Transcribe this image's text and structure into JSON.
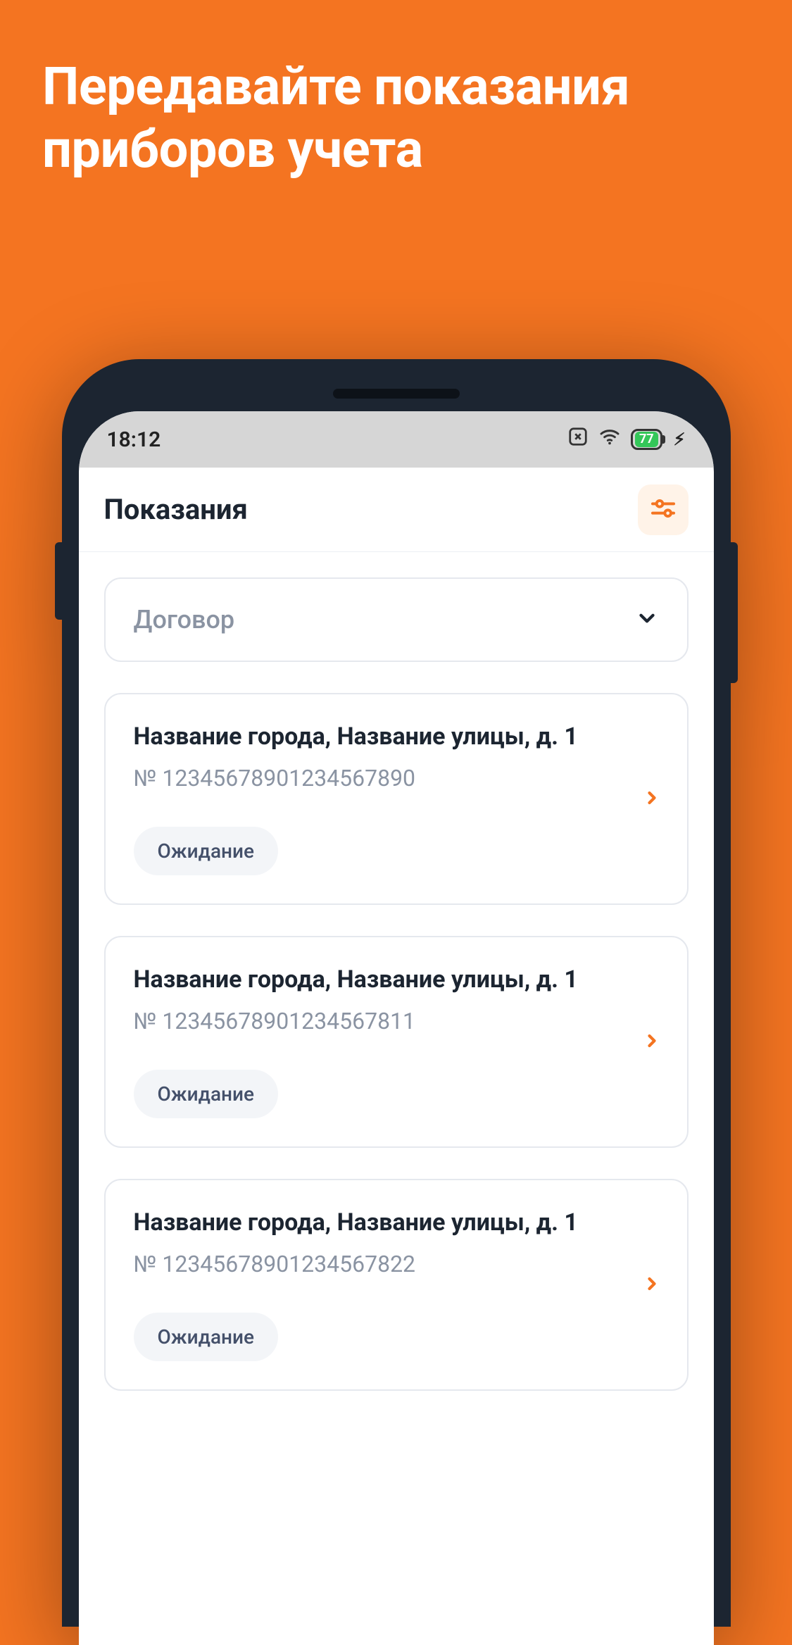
{
  "promo": {
    "title_line1": "Передавайте показания",
    "title_line2": "приборов учета"
  },
  "status": {
    "time": "18:12",
    "battery": "77"
  },
  "app_bar": {
    "title": "Показания"
  },
  "dropdown": {
    "label": "Договор"
  },
  "cards": [
    {
      "title": "Название города, Название улицы, д. 1",
      "number": "№ 12345678901234567890",
      "status": "Ожидание"
    },
    {
      "title": "Название города, Название улицы, д. 1",
      "number": "№ 12345678901234567811",
      "status": "Ожидание"
    },
    {
      "title": "Название города, Название улицы, д. 1",
      "number": "№ 12345678901234567822",
      "status": "Ожидание"
    }
  ]
}
